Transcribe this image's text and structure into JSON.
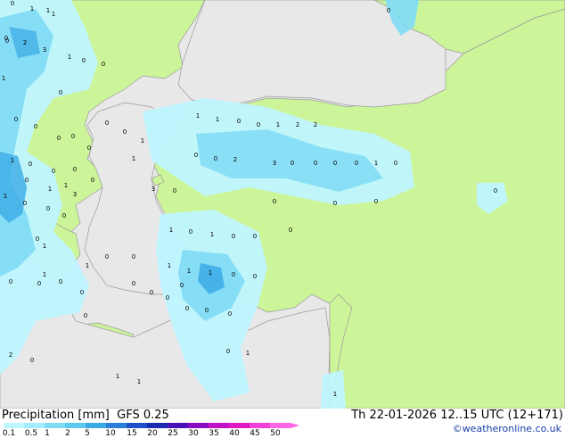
{
  "title": {
    "left": "Precipitation [mm]  GFS 0.25",
    "right": "Th 22-01-2026 12..15 UTC (12+171)"
  },
  "credit": "©weatheronline.co.uk",
  "legend": {
    "ticks": [
      "0.1",
      "0.5",
      "1",
      "2",
      "5",
      "10",
      "15",
      "20",
      "25",
      "30",
      "35",
      "40",
      "45",
      "50"
    ],
    "colors": [
      "#bff5ff",
      "#a3ecff",
      "#7fdcf5",
      "#5cc8ee",
      "#3aaae6",
      "#2a7ed8",
      "#1f50c8",
      "#1b2cb0",
      "#4a10b8",
      "#8a0cc0",
      "#c010c8",
      "#e018c8",
      "#f040d8",
      "#ff66e6"
    ]
  },
  "colors": {
    "sea": "#e8e8e8",
    "land": "#ccf59a",
    "coast": "#9a9a9a",
    "precip_light": "#bff5ff",
    "precip_medium": "#7fdcf5",
    "precip_heavy": "#3aaae6"
  },
  "values": [
    "0",
    "1",
    "1",
    "1",
    "0",
    "0",
    "2",
    "3",
    "1",
    "0",
    "0",
    "0",
    "1",
    "0",
    "0",
    "0",
    "0",
    "0",
    "1",
    "0",
    "0",
    "0",
    "0",
    "3",
    "0",
    "1",
    "1",
    "0",
    "0",
    "1",
    "2",
    "2",
    "0",
    "0",
    "2",
    "3",
    "0",
    "0",
    "0",
    "0",
    "1",
    "0",
    "0",
    "0",
    "0",
    "0",
    "0",
    "1",
    "0",
    "1",
    "0",
    "0",
    "0",
    "1",
    "1",
    "1",
    "0",
    "0",
    "0",
    "0",
    "0",
    "0",
    "1",
    "1",
    "1",
    "1",
    "0",
    "0",
    "0",
    "0",
    "0",
    "0",
    "0",
    "0",
    "0",
    "1",
    "1",
    "0",
    "1",
    "1",
    "3",
    "2",
    "0",
    "1",
    "1",
    "0",
    "0",
    "0",
    "0",
    "0",
    "0",
    "1",
    "1",
    "0",
    "0"
  ]
}
